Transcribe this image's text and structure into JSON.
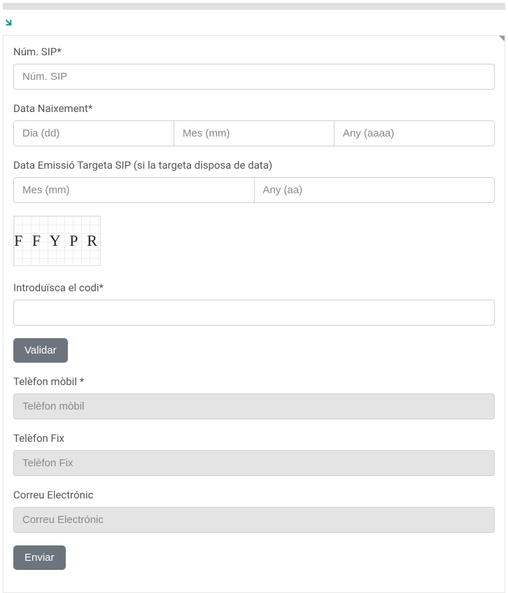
{
  "labels": {
    "num_sip": "Núm. SIP*",
    "data_naixement": "Data Naixement*",
    "data_emissio": "Data Emissió Targeta SIP (si la targeta disposa de data)",
    "introduisca_codi": "Introduïsca el codi*",
    "telefon_mobil": "Telèfon mòbil *",
    "telefon_fix": "Telèfon Fix",
    "correu_electronic": "Correu Electrónic"
  },
  "placeholders": {
    "num_sip": "Núm. SIP",
    "dia": "Dia (dd)",
    "mes": "Mes (mm)",
    "any": "Any (aaaa)",
    "mes_emissio": "Mes (mm)",
    "any_emissio": "Any (aa)",
    "telefon_mobil": "Telèfon mòbil",
    "telefon_fix": "Telèfon Fix",
    "correu_electronic": "Correu Electrónic"
  },
  "captcha": {
    "text": "F F Y P R"
  },
  "buttons": {
    "validar": "Validar",
    "enviar": "Enviar"
  }
}
